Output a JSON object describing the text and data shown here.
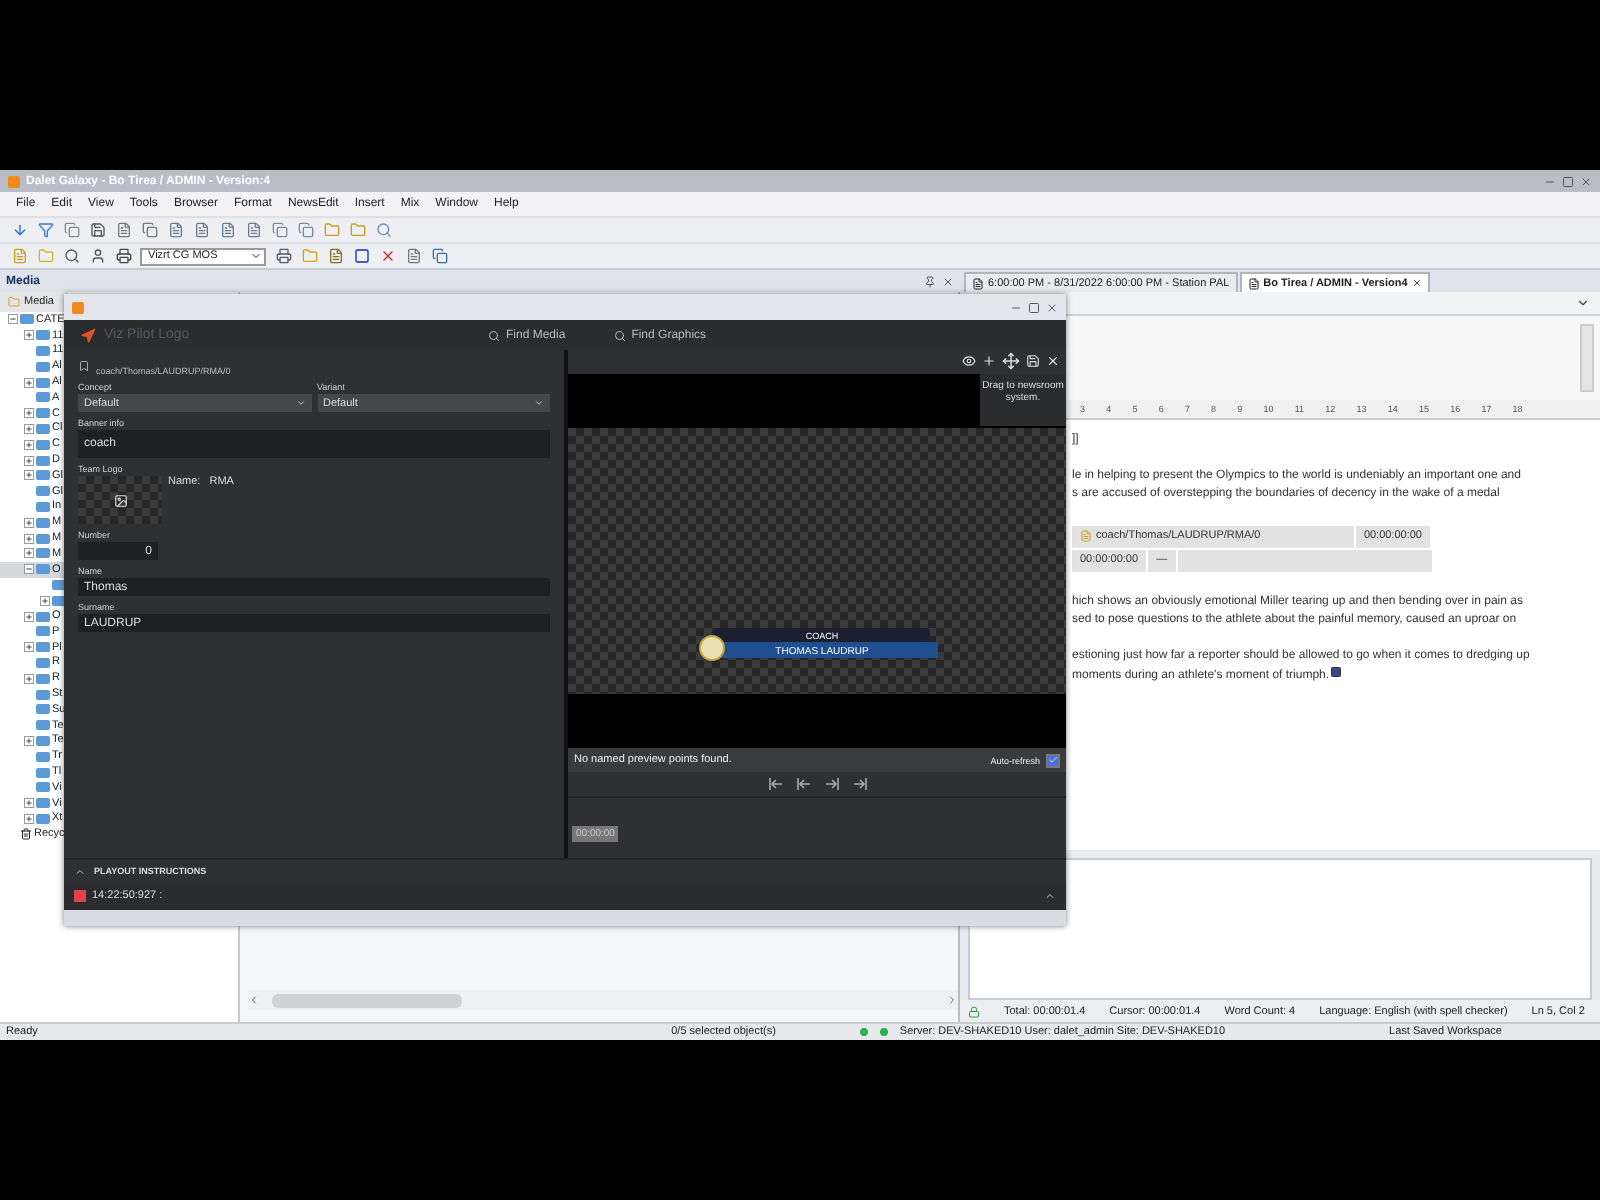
{
  "window": {
    "title": "Dalet Galaxy - Bo Tirea / ADMIN - Version:4"
  },
  "menu": [
    "File",
    "Edit",
    "View",
    "Tools",
    "Browser",
    "Format",
    "NewsEdit",
    "Insert",
    "Mix",
    "Window",
    "Help"
  ],
  "toolbar": {
    "dropdown": "Vizrt CG MOS"
  },
  "media_panel": {
    "title": "Media",
    "tab": "Media",
    "tree": [
      {
        "label": "CATE",
        "kind": "branch",
        "expanded": true,
        "selected": false,
        "children": [
          {
            "label": "11",
            "kind": "branch",
            "expanded": false,
            "selected": false
          },
          {
            "label": "11",
            "kind": "leaf",
            "selected": false
          },
          {
            "label": "Al",
            "kind": "leaf",
            "selected": false
          },
          {
            "label": "Al",
            "kind": "branch",
            "expanded": false,
            "selected": false
          },
          {
            "label": "A",
            "kind": "leaf",
            "selected": false
          },
          {
            "label": "C",
            "kind": "branch",
            "expanded": false,
            "selected": false
          },
          {
            "label": "Cl",
            "kind": "branch",
            "expanded": false,
            "selected": false
          },
          {
            "label": "C",
            "kind": "branch",
            "expanded": false,
            "selected": false
          },
          {
            "label": "D",
            "kind": "branch",
            "expanded": false,
            "selected": false
          },
          {
            "label": "Gl",
            "kind": "branch",
            "expanded": false,
            "selected": false
          },
          {
            "label": "Gl",
            "kind": "leaf",
            "selected": false
          },
          {
            "label": "In",
            "kind": "leaf",
            "selected": false
          },
          {
            "label": "M",
            "kind": "branch",
            "expanded": false,
            "selected": false
          },
          {
            "label": "M",
            "kind": "branch",
            "expanded": false,
            "selected": false
          },
          {
            "label": "M",
            "kind": "branch",
            "expanded": false,
            "selected": false
          },
          {
            "label": "O",
            "kind": "branch",
            "expanded": true,
            "selected": true,
            "children": [
              {
                "kind": "leaf",
                "selected": false
              },
              {
                "kind": "branch",
                "expanded": false,
                "selected": false
              }
            ]
          },
          {
            "label": "O",
            "kind": "branch",
            "expanded": false,
            "selected": false
          },
          {
            "label": "P",
            "kind": "leaf",
            "selected": false
          },
          {
            "label": "Pl",
            "kind": "branch",
            "expanded": false,
            "selected": false
          },
          {
            "label": "R",
            "kind": "leaf",
            "selected": false
          },
          {
            "label": "R",
            "kind": "branch",
            "expanded": false,
            "selected": false
          },
          {
            "label": "St",
            "kind": "leaf",
            "selected": false
          },
          {
            "label": "Su",
            "kind": "leaf",
            "selected": false
          },
          {
            "label": "Te",
            "kind": "leaf",
            "selected": false
          },
          {
            "label": "Te",
            "kind": "branch",
            "expanded": false,
            "selected": false
          },
          {
            "label": "Tr",
            "kind": "leaf",
            "selected": false
          },
          {
            "label": "Tl",
            "kind": "leaf",
            "selected": false
          },
          {
            "label": "Vi",
            "kind": "leaf",
            "selected": false
          },
          {
            "label": "Vi",
            "kind": "branch",
            "expanded": false,
            "selected": false
          },
          {
            "label": "Xt",
            "kind": "branch",
            "expanded": false,
            "selected": false
          }
        ]
      },
      {
        "label": "Recyc",
        "kind": "leaf",
        "selected": false
      }
    ]
  },
  "document_tabs": [
    {
      "label": "6:00:00 PM - 8/31/2022 6:00:00 PM - Station PAL",
      "selected": false
    },
    {
      "label": "Bo Tirea / ADMIN - Version4",
      "selected": true
    }
  ],
  "dialog": {
    "logo": "Viz Pilot Logo",
    "actions": [
      "Find Media",
      "Find Graphics"
    ],
    "path": "coach/Thomas/LAUDRUP/RMA/0",
    "concept": {
      "label": "Concept",
      "value": "Default"
    },
    "variant": {
      "label": "Variant",
      "value": "Default"
    },
    "banner_info": {
      "label": "Banner info",
      "value": "coach"
    },
    "team_logo": {
      "label": "Team Logo",
      "name_label": "Name:",
      "name": "RMA"
    },
    "number": {
      "label": "Number",
      "value": "0"
    },
    "name": {
      "label": "Name",
      "value": "Thomas"
    },
    "surname": {
      "label": "Surname",
      "value": "LAUDRUP"
    },
    "tooltip": "Drag to newsroom system.",
    "preview": {
      "title": "COACH",
      "name": "THOMAS LAUDRUP"
    },
    "preview_points": "No named preview points found.",
    "auto_refresh": {
      "label": "Auto-refresh",
      "checked": true
    },
    "timecode": "00:00:00",
    "playout": {
      "title": "PLAYOUT INSTRUCTIONS",
      "entry": "14:22:50:927 :"
    }
  },
  "document": {
    "ruler": [
      "3",
      "4",
      "5",
      "6",
      "7",
      "8",
      "9",
      "10",
      "11",
      "12",
      "13",
      "14",
      "15",
      "16",
      "17",
      "18"
    ],
    "heading": "]]",
    "paragraphs": [
      {
        "kind": "text",
        "lines": [
          "le in helping to present the Olympics to the world is undeniably an important one and",
          "s are accused of overstepping the boundaries of decency in the wake of a medal"
        ]
      },
      {
        "kind": "item",
        "path": "coach/Thomas/LAUDRUP/RMA/0",
        "time": "00:00:00:00",
        "start": "00:00:00:00",
        "dash": "—"
      },
      {
        "kind": "text",
        "lines": [
          "hich shows an obviously emotional Miller tearing up and then bending over in pain as",
          "sed to pose questions to the athlete about the painful memory, caused an uproar on"
        ]
      },
      {
        "kind": "text",
        "lines": [
          "estioning just how far a reporter should be allowed to go when it comes to dredging up",
          "moments during an athlete's moment of triumph."
        ]
      }
    ],
    "status": [
      "Total: 00:00:01.4",
      "Cursor: 00:00:01.4",
      "Word Count: 4",
      "Language: English (with spell checker)",
      "Ln 5, Col 2"
    ]
  },
  "status_bar": {
    "ready": "Ready",
    "selection": "0/5 selected object(s)",
    "server": "Server: DEV-SHAKED10 User: dalet_admin Site: DEV-SHAKED10",
    "workspace": "Last Saved Workspace"
  }
}
